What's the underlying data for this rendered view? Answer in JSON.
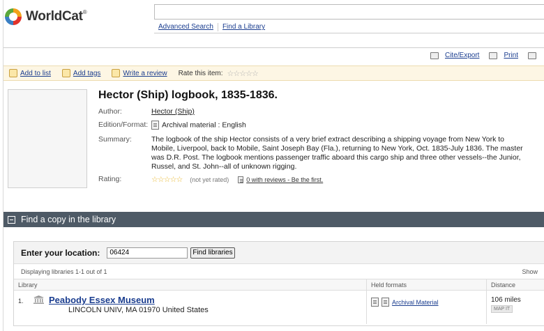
{
  "brand": {
    "name": "WorldCat",
    "mark": "®"
  },
  "header": {
    "search_value": "",
    "nav": [
      "Advanced Search",
      "Find a Library"
    ]
  },
  "tools": {
    "cite": "Cite/Export",
    "print": "Print"
  },
  "actions": {
    "add_list": "Add to list",
    "add_tags": "Add tags",
    "write_review": "Write a review",
    "rate_label": "Rate this item:",
    "stars": "☆☆☆☆☆"
  },
  "record": {
    "title": "Hector (Ship) logbook, 1835-1836.",
    "author_label": "Author:",
    "author": "Hector (Ship)",
    "edition_label": "Edition/Format:",
    "edition": "Archival material : English",
    "summary_label": "Summary:",
    "summary": "The logbook of the ship Hector consists of a very brief extract describing a shipping voyage from New York to Mobile, Liverpool, back to Mobile, Saint Joseph Bay (Fla.), returning to New York, Oct. 1835-July 1836. The master was D.R. Post. The logbook mentions passenger traffic aboard this cargo ship and three other vessels--the Junior, Russel, and St. John--all of unknown rigging.",
    "rating_label": "Rating:",
    "rating_stars": "☆☆☆☆☆",
    "rating_note": "(not yet rated)",
    "reviews": "0 with reviews - Be the first."
  },
  "find_copy": {
    "heading": "Find a copy in the library",
    "loc_label": "Enter your location:",
    "loc_value": "06424",
    "button": "Find libraries",
    "displaying": "Displaying libraries 1-1 out of 1",
    "show": "Show",
    "columns": [
      "Library",
      "Held formats",
      "Distance"
    ],
    "rows": [
      {
        "num": "1.",
        "name": "Peabody Essex Museum",
        "address": "LINCOLN UNIV, MA 01970 United States",
        "format": "Archival Material",
        "distance": "106 miles",
        "map": "MAP IT"
      }
    ]
  }
}
